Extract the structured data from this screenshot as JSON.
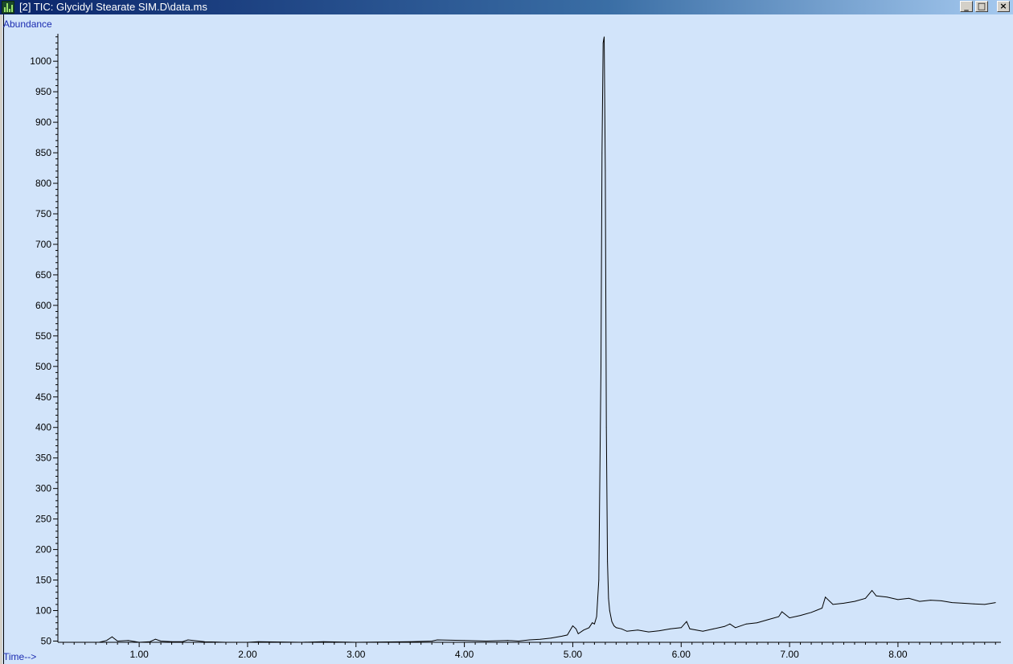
{
  "window": {
    "title": "[2] TIC: Glycidyl Stearate SIM.D\\data.ms",
    "icon": "chromatogram-app-icon",
    "buttons": {
      "minimize": "_",
      "maximize": "□",
      "close": "×"
    }
  },
  "colors": {
    "plot_background": "#d2e4fa",
    "trace": "#000000",
    "axis_name": "#1b2bb0"
  },
  "chart_data": {
    "type": "line",
    "title": "TIC: Glycidyl Stearate SIM.D\\data.ms",
    "ylabel": "Abundance",
    "xlabel": "Time-->",
    "xlim": [
      0.25,
      8.95
    ],
    "ylim": [
      48,
      1045
    ],
    "xticks": [
      "1.00",
      "2.00",
      "3.00",
      "4.00",
      "5.00",
      "6.00",
      "7.00",
      "8.00"
    ],
    "yticks": [
      "50",
      "100",
      "150",
      "200",
      "250",
      "300",
      "350",
      "400",
      "450",
      "500",
      "550",
      "600",
      "650",
      "700",
      "750",
      "800",
      "850",
      "900",
      "950",
      "1000"
    ],
    "grid": false,
    "series": [
      {
        "x": [
          0.63,
          0.7,
          0.75,
          0.8,
          0.9,
          1.0,
          1.1,
          1.15,
          1.2,
          1.3,
          1.4,
          1.45,
          1.6,
          1.8,
          2.0,
          2.1,
          2.5,
          2.7,
          3.0,
          3.5,
          3.7,
          3.75,
          4.0,
          4.2,
          4.4,
          4.5,
          4.6,
          4.7,
          4.8,
          4.9,
          4.95,
          5.0,
          5.03,
          5.05,
          5.1,
          5.15,
          5.18,
          5.2,
          5.22,
          5.24,
          5.26,
          5.27,
          5.28,
          5.29,
          5.3,
          5.31,
          5.32,
          5.33,
          5.34,
          5.36,
          5.38,
          5.4,
          5.45,
          5.5,
          5.6,
          5.7,
          5.8,
          5.9,
          6.0,
          6.05,
          6.08,
          6.2,
          6.3,
          6.4,
          6.45,
          6.5,
          6.6,
          6.7,
          6.8,
          6.9,
          6.93,
          7.0,
          7.1,
          7.2,
          7.3,
          7.33,
          7.4,
          7.5,
          7.6,
          7.7,
          7.76,
          7.8,
          7.9,
          8.0,
          8.1,
          8.2,
          8.3,
          8.4,
          8.5,
          8.6,
          8.7,
          8.8,
          8.9
        ],
        "y": [
          48,
          51,
          57,
          50,
          51,
          48,
          49,
          53,
          50,
          49,
          49,
          52,
          49,
          48,
          48,
          49,
          48,
          49,
          48,
          49,
          50,
          52,
          51,
          50,
          51,
          50,
          52,
          53,
          55,
          58,
          60,
          75,
          70,
          62,
          68,
          72,
          80,
          78,
          90,
          150,
          500,
          850,
          1030,
          1040,
          820,
          400,
          180,
          120,
          100,
          82,
          75,
          72,
          70,
          66,
          68,
          65,
          67,
          70,
          72,
          82,
          70,
          66,
          70,
          74,
          78,
          72,
          78,
          80,
          85,
          90,
          98,
          88,
          92,
          97,
          104,
          122,
          110,
          112,
          115,
          120,
          133,
          124,
          122,
          118,
          120,
          115,
          117,
          116,
          113,
          112,
          111,
          110,
          113
        ]
      }
    ]
  }
}
